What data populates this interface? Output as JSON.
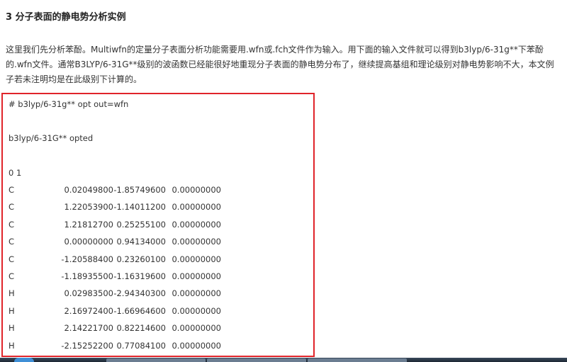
{
  "article": {
    "heading": "3 分子表面的静电势分析实例",
    "paragraph": [
      "这里我们先分析苯酚。Multiwfn的定量分子表面分析功能需要用.wfn或.fch文件作为输入。用下面的输入文件就可以得到b3lyp/6-31g**下苯酚",
      "的.wfn文件。通常B3LYP/6-31G**级别的波函数已经能很好地重现分子表面的静电势分布了，继续提高基组和理论级别对静电势影响不大，本文例",
      "子若未注明均是在此级别下计算的。"
    ]
  },
  "input_file": {
    "route_line": "# b3lyp/6-31g** opt out=wfn",
    "title_line": "b3lyp/6-31G** opted",
    "charge_multiplicity": "0 1",
    "atoms": [
      {
        "element": "C",
        "x": "0.02049800",
        "y": "-1.85749600",
        "z": "0.00000000"
      },
      {
        "element": "C",
        "x": "1.22053900",
        "y": "-1.14011200",
        "z": "0.00000000"
      },
      {
        "element": "C",
        "x": "1.21812700",
        "y": "0.25255100",
        "z": "0.00000000"
      },
      {
        "element": "C",
        "x": "0.00000000",
        "y": "0.94134000",
        "z": "0.00000000"
      },
      {
        "element": "C",
        "x": "-1.20588400",
        "y": "0.23260100",
        "z": "0.00000000"
      },
      {
        "element": "C",
        "x": "-1.18935500",
        "y": "-1.16319600",
        "z": "0.00000000"
      },
      {
        "element": "H",
        "x": "0.02983500",
        "y": "-2.94340300",
        "z": "0.00000000"
      },
      {
        "element": "H",
        "x": "2.16972400",
        "y": "-1.66964600",
        "z": "0.00000000"
      },
      {
        "element": "H",
        "x": "2.14221700",
        "y": "0.82214600",
        "z": "0.00000000"
      },
      {
        "element": "H",
        "x": "-2.15252200",
        "y": "0.77084100",
        "z": "0.00000000"
      }
    ]
  },
  "colors": {
    "highlight_border": "#e0242a",
    "taskbar": "#1d2733"
  }
}
